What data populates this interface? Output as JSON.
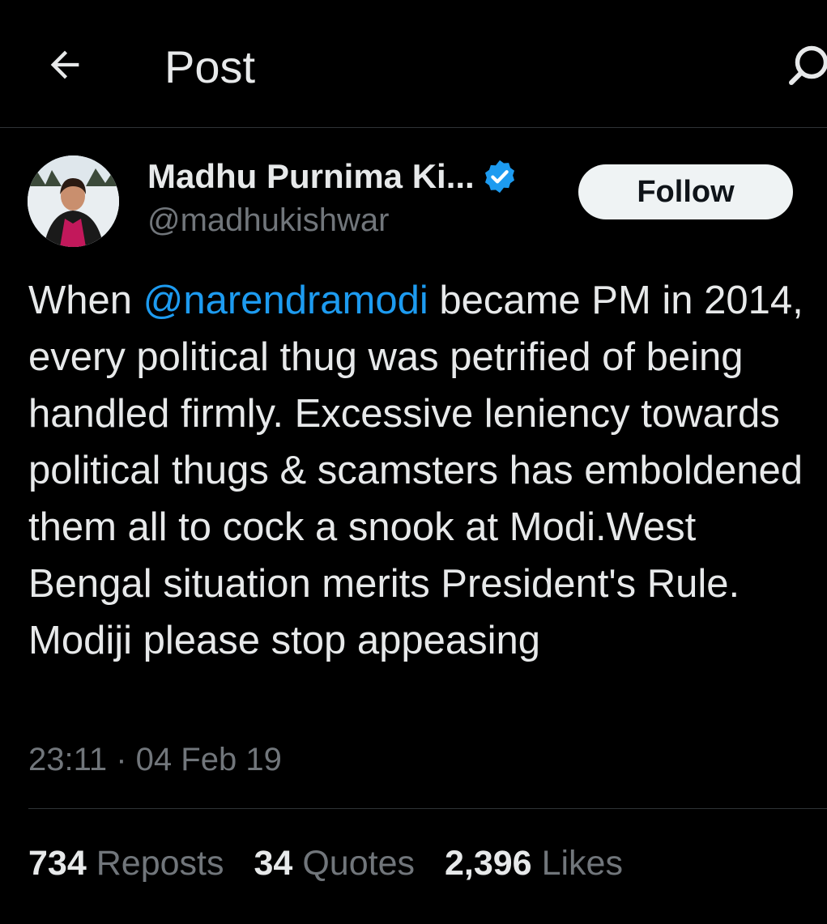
{
  "header": {
    "title": "Post",
    "back_icon": "arrow-left-icon",
    "search_icon": "search-icon"
  },
  "author": {
    "display_name": "Madhu Purnima Ki...",
    "handle": "@madhukishwar",
    "verified": true,
    "verified_color": "#1d9bf0"
  },
  "follow_button": {
    "label": "Follow"
  },
  "tweet": {
    "text_before_mention": "When ",
    "mention": "@narendramodi",
    "text_after_mention": " became PM in 2014, every political thug was petrified of being handled firmly. Excessive leniency towards political thugs & scamsters has emboldened them all to cock a snook at Modi.West Bengal situation merits President's Rule. Modiji please stop appeasing",
    "timestamp": "23:11 · 04 Feb 19"
  },
  "stats": [
    {
      "count": "734",
      "label": "Reposts"
    },
    {
      "count": "34",
      "label": "Quotes"
    },
    {
      "count": "2,396",
      "label": "Likes"
    }
  ],
  "colors": {
    "background": "#000000",
    "primary_text": "#e7e9ea",
    "secondary_text": "#71767b",
    "link": "#1d9bf0",
    "divider": "#2f3336"
  }
}
